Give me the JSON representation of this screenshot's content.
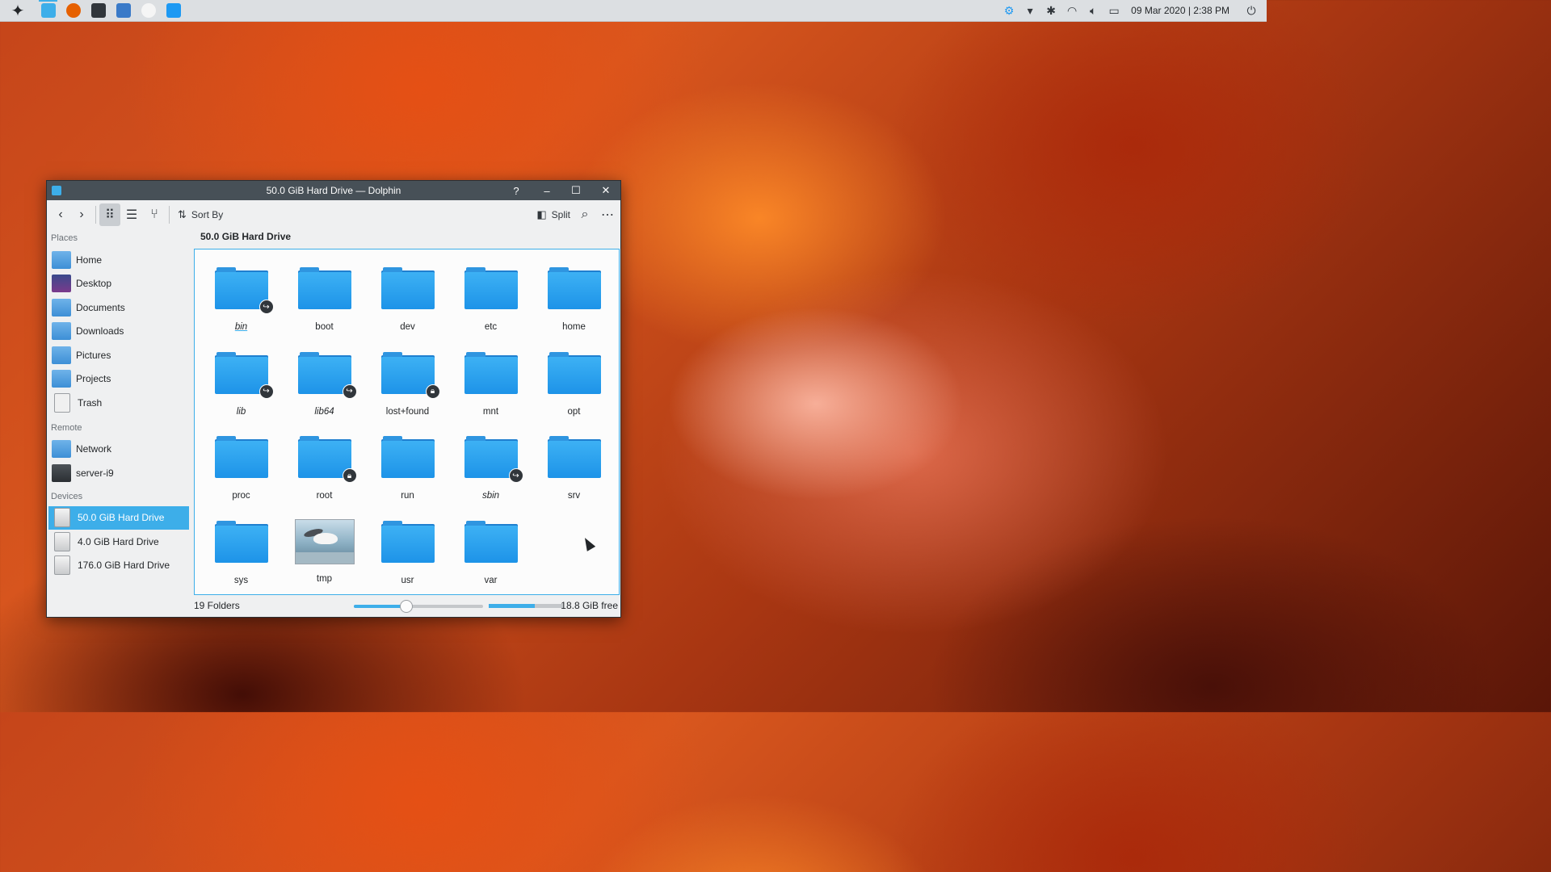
{
  "panel": {
    "launcher_icon": "kde-launcher-icon",
    "tasks": [
      {
        "name": "dolphin",
        "color": "#3daee9",
        "active": true
      },
      {
        "name": "firefox",
        "color": "#e66000",
        "active": false
      },
      {
        "name": "terminal",
        "color": "#31363b",
        "active": false
      },
      {
        "name": "discover",
        "color": "#3a7ac8",
        "active": false
      },
      {
        "name": "x-app",
        "color": "#f5f5f5",
        "active": false
      },
      {
        "name": "system-settings",
        "color": "#1d99f3",
        "active": false
      }
    ],
    "clock": "09 Mar 2020 | 2:38 PM"
  },
  "window": {
    "title": "50.0 GiB Hard Drive — Dolphin",
    "toolbar": {
      "sort_label": "Sort By",
      "split_label": "Split"
    },
    "path": "50.0 GiB Hard Drive",
    "sidebar": {
      "places_header": "Places",
      "places": [
        "Home",
        "Desktop",
        "Documents",
        "Downloads",
        "Pictures",
        "Projects",
        "Trash"
      ],
      "remote_header": "Remote",
      "remote": [
        "Network",
        "server-i9"
      ],
      "devices_header": "Devices",
      "devices": [
        "50.0 GiB Hard Drive",
        "4.0 GiB Hard Drive",
        "176.0 GiB Hard Drive"
      ],
      "selected_device": "50.0 GiB Hard Drive"
    },
    "folders": [
      {
        "name": "bin",
        "italic": true,
        "emblem": "symlink"
      },
      {
        "name": "boot"
      },
      {
        "name": "dev"
      },
      {
        "name": "etc"
      },
      {
        "name": "home"
      },
      {
        "name": "lib",
        "italic": true,
        "emblem": "symlink"
      },
      {
        "name": "lib64",
        "italic": true,
        "emblem": "symlink"
      },
      {
        "name": "lost+found",
        "emblem": "lock"
      },
      {
        "name": "mnt"
      },
      {
        "name": "opt"
      },
      {
        "name": "proc"
      },
      {
        "name": "root",
        "emblem": "lock"
      },
      {
        "name": "run"
      },
      {
        "name": "sbin",
        "italic": true,
        "emblem": "symlink"
      },
      {
        "name": "srv"
      },
      {
        "name": "sys"
      },
      {
        "name": "tmp",
        "thumbnail": true
      },
      {
        "name": "usr"
      },
      {
        "name": "var"
      }
    ],
    "status": {
      "count": "19 Folders",
      "free": "18.8 GiB free",
      "zoom_level": 0.4,
      "disk_used_fraction": 0.62
    }
  },
  "colors": {
    "accent": "#3daee9",
    "titlebar": "#475057"
  }
}
